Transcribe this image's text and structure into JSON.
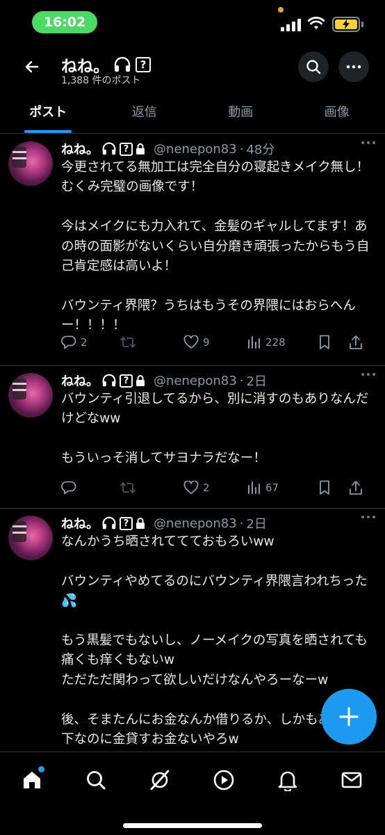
{
  "status_bar": {
    "time": "16:02"
  },
  "header": {
    "name": "ねね。",
    "post_count": "1,388 件のポスト"
  },
  "tabs": [
    {
      "label": "ポスト",
      "active": true
    },
    {
      "label": "返信",
      "active": false
    },
    {
      "label": "動画",
      "active": false
    },
    {
      "label": "画像",
      "active": false
    }
  ],
  "posts": [
    {
      "name": "ねね。",
      "handle": "@nenepon83",
      "time": "48分",
      "body": "今更されてる無加工は完全自分の寝起きメイク無し！むくみ完璧の画像です！\n\n今はメイクにも力入れて、金髪のギャルしてます！あの時の面影がないくらい自分磨き頑張ったからもう自己肯定感は高いよ！\n\nバウンティ界隈？うちはもうその界隈にはおらへんー！！！！",
      "replies": "2",
      "reposts": "",
      "likes": "9",
      "views": "228"
    },
    {
      "name": "ねね。",
      "handle": "@nenepon83",
      "time": "2日",
      "body": "バウンティ引退してるから、別に消すのもありなんだけどなww\n\nもういっそ消してサヨナラだなー！",
      "replies": "",
      "reposts": "",
      "likes": "2",
      "views": "67"
    },
    {
      "name": "ねね。",
      "handle": "@nenepon83",
      "time": "2日",
      "body": "なんかうち晒されててておもろいww\n\nバウンティやめてるのにバウンティ界隈言われちった💦\n\nもう黒髪でもないし、ノーメイクの写真を晒されても痛くも痒くもないw\nただただ関わって欲しいだけなんやろーなーw\n\n後、そまたんにお金なんか借りるか、しかもあいつ年下なのに金貸すお金ないやろw",
      "replies": "",
      "reposts": "",
      "likes": "",
      "views": ""
    }
  ],
  "icons": {
    "back": "arrow-left-icon",
    "search": "search-icon",
    "more": "more-icon",
    "headphones": "headphones-icon",
    "question": "question-box-icon",
    "lock": "lock-icon",
    "fab": "plus-icon"
  },
  "bottom_nav": [
    {
      "name": "home",
      "badge": true
    },
    {
      "name": "search",
      "badge": false
    },
    {
      "name": "grok",
      "badge": false
    },
    {
      "name": "video",
      "badge": false
    },
    {
      "name": "notifications",
      "badge": false
    },
    {
      "name": "messages",
      "badge": false
    }
  ],
  "colors": {
    "accent": "#1d9bf0",
    "time_pill": "#4cd964",
    "battery": "#f7d038"
  }
}
